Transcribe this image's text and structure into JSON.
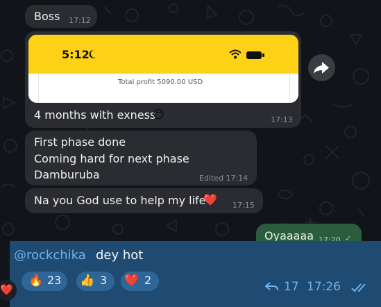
{
  "messages": {
    "boss": {
      "text": "Boss",
      "time": "17:12"
    },
    "screenshot": {
      "status_time": "5:12",
      "profit_text": "Total profit 5090.00 USD",
      "caption": "4 months with exness",
      "caption_emoji": "😶",
      "time": "17:13"
    },
    "phase": {
      "line1": "First phase done",
      "line2": "Coming hard for next phase",
      "line3": "Damburuba",
      "edited_time": "Edited 17:14"
    },
    "god": {
      "text": "Na you God use to help my life",
      "emoji": "❤️",
      "time": "17:15"
    },
    "own": {
      "text": "Oyaaaaa",
      "time": "17:20"
    }
  },
  "reply": {
    "mention": "@rockchika",
    "text": "dey hot",
    "reactions": [
      {
        "emoji": "🔥",
        "count": "23"
      },
      {
        "emoji": "👍",
        "count": "3"
      },
      {
        "emoji": "❤️",
        "count": "2"
      }
    ],
    "forward_count": "17",
    "time": "17:26"
  },
  "side_reaction": "❤️",
  "colors": {
    "background": "#111418",
    "incoming_bubble": "#2a2c31",
    "outgoing_bubble": "#2b5d3c",
    "highlight_panel": "#1f4a72",
    "reaction_pill": "#2f6698",
    "app_header": "#fcd116"
  }
}
